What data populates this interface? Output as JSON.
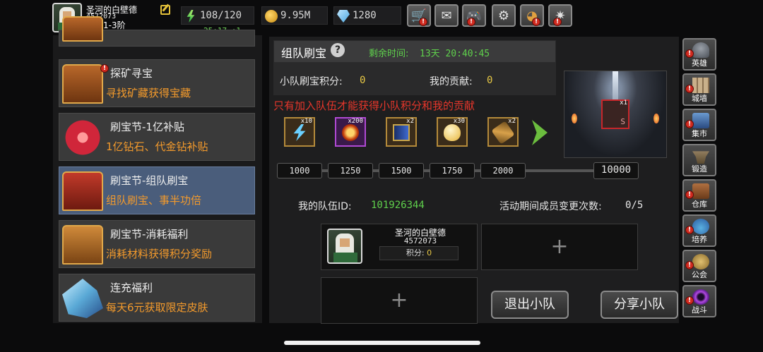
{
  "player": {
    "name": "圣河的白壁德",
    "id": "4572073",
    "rank": "勇者1-3阶"
  },
  "resources": {
    "energy": "108/120",
    "energy_timer": "25:17 +1",
    "gold": "9.95M",
    "gems": "1280"
  },
  "top_buttons": [
    {
      "icon": "cart-icon"
    },
    {
      "icon": "mail-icon"
    },
    {
      "icon": "gamepad-icon"
    },
    {
      "icon": "gear-icon"
    },
    {
      "icon": "pie-chart-icon"
    },
    {
      "icon": "fireworks-icon"
    }
  ],
  "events": [
    {
      "title": "探矿寻宝",
      "desc": "寻找矿藏获得宝藏"
    },
    {
      "title": "刷宝节-1亿补贴",
      "desc": "1亿钻石、代金钻补贴"
    },
    {
      "title": "刷宝节-组队刷宝",
      "desc": "组队刷宝、事半功倍"
    },
    {
      "title": "刷宝节-消耗福利",
      "desc": "消耗材料获得积分奖励"
    },
    {
      "title": "连充福利",
      "desc": "每天6元获取限定皮肤"
    }
  ],
  "panel": {
    "title": "组队刷宝",
    "remaining_label": "剩余时间:",
    "remaining_value": "13天 20:40:45",
    "team_score_label": "小队刷宝积分:",
    "team_score_value": "0",
    "my_contrib_label": "我的贡献:",
    "my_contrib_value": "0",
    "warning": "只有加入队伍才能获得小队积分和我的贡献",
    "rewards": [
      {
        "icon": "lightning-icon",
        "qty": "x10"
      },
      {
        "icon": "fire-orb-icon",
        "qty": "x200"
      },
      {
        "icon": "book-icon",
        "qty": "x2"
      },
      {
        "icon": "egg-icon",
        "qty": "x30"
      },
      {
        "icon": "scroll-icon",
        "qty": "x2"
      }
    ],
    "milestones": [
      "1000",
      "1250",
      "1500",
      "1750",
      "2000",
      "10000"
    ],
    "card_qty": "x1",
    "card_letter": "S"
  },
  "team": {
    "team_id_label": "我的队伍ID:",
    "team_id_value": "101926344",
    "changes_label": "活动期间成员变更次数:",
    "changes_value": "0/5",
    "member": {
      "name": "圣河的白壁德",
      "id": "4572073",
      "score_label": "积分:",
      "score_value": "0"
    },
    "empty_slot": "+",
    "leave_button": "退出小队",
    "share_button": "分享小队"
  },
  "side_nav": [
    {
      "label": "英雄",
      "icon": "helmet-icon"
    },
    {
      "label": "城墙",
      "icon": "wall-icon"
    },
    {
      "label": "集市",
      "icon": "market-icon"
    },
    {
      "label": "锻造",
      "icon": "anvil-icon"
    },
    {
      "label": "仓库",
      "icon": "warehouse-icon"
    },
    {
      "label": "培养",
      "icon": "potion-icon"
    },
    {
      "label": "公会",
      "icon": "guild-icon"
    },
    {
      "label": "战斗",
      "icon": "portal-icon"
    }
  ],
  "colors": {
    "accent_orange": "#f39a2c",
    "accent_green": "#5fd04c",
    "warning_red": "#e5362b",
    "active_item": "#4a5d7b"
  }
}
